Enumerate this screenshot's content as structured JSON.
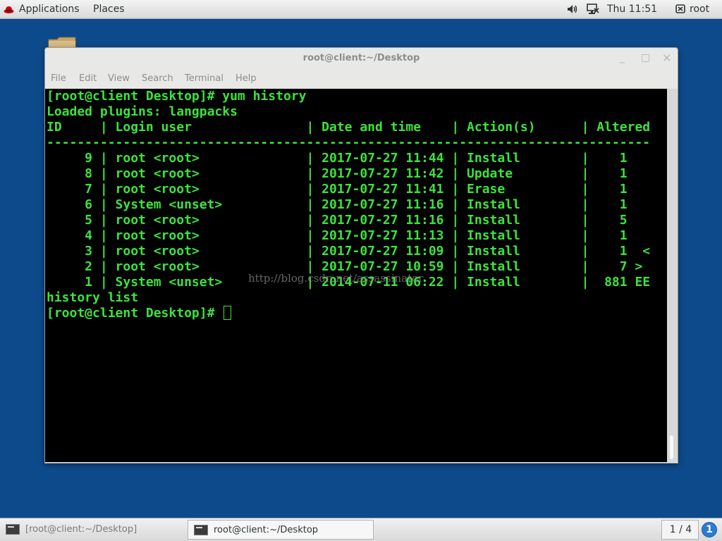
{
  "top_panel": {
    "applications": "Applications",
    "places": "Places",
    "clock": "Thu 11:51",
    "user": "root",
    "icons": [
      "redhat-icon",
      "volume-icon",
      "network-icon",
      "user-icon"
    ]
  },
  "window": {
    "title": "root@client:~/Desktop",
    "buttons": {
      "minimize": "_",
      "maximize": "□",
      "close": "×"
    },
    "menu": [
      "File",
      "Edit",
      "View",
      "Search",
      "Terminal",
      "Help"
    ]
  },
  "terminal": {
    "lines": [
      "[root@client Desktop]# yum history",
      "Loaded plugins: langpacks",
      "ID     | Login user               | Date and time    | Action(s)      | Altered",
      "-------------------------------------------------------------------------------",
      "     9 | root <root>              | 2017-07-27 11:44 | Install        |    1   ",
      "     8 | root <root>              | 2017-07-27 11:42 | Update         |    1   ",
      "     7 | root <root>              | 2017-07-27 11:41 | Erase          |    1   ",
      "     6 | System <unset>           | 2017-07-27 11:16 | Install        |    1   ",
      "     5 | root <root>              | 2017-07-27 11:16 | Install        |    5   ",
      "     4 | root <root>              | 2017-07-27 11:13 | Install        |    1   ",
      "     3 | root <root>              | 2017-07-27 11:09 | Install        |    1  <",
      "     2 | root <root>              | 2017-07-27 10:59 | Install        |    7 > ",
      "     1 | System <unset>           | 2014-07-11 06:22 | Install        |  881 EE",
      "history list",
      "[root@client Desktop]# "
    ],
    "text_color": "#3ce33c",
    "background": "#000000"
  },
  "watermark": "http://blog.csdn.net/assassinator",
  "taskbar": {
    "tasks": [
      "[root@client:~/Desktop]",
      "root@client:~/Desktop"
    ],
    "workspace": "1 / 4",
    "notification": "1"
  }
}
